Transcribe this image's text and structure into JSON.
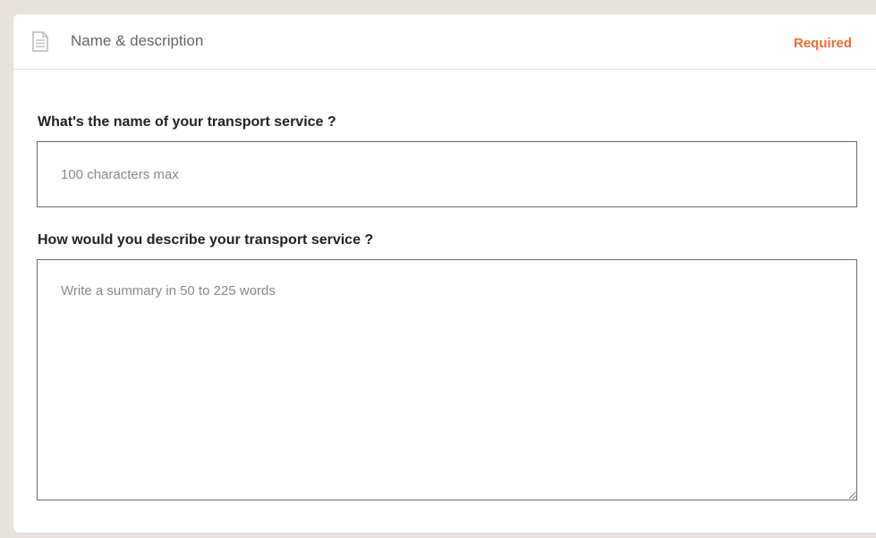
{
  "header": {
    "title": "Name & description",
    "required_label": "Required",
    "icon": "document-icon"
  },
  "form": {
    "name_question": "What's the name of your transport service ?",
    "name_placeholder": "100 characters max",
    "name_value": "",
    "description_question": "How would you describe your transport service ?",
    "description_placeholder": "Write a summary in 50 to 225 words",
    "description_value": ""
  },
  "colors": {
    "background": "#e8e3dc",
    "card": "#ffffff",
    "required": "#f06b2a",
    "field_border": "#6b6b6b"
  }
}
